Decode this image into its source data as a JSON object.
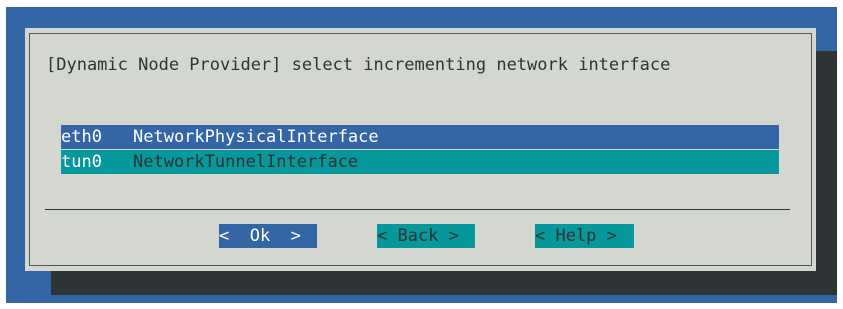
{
  "dialog": {
    "title": "[Dynamic Node Provider] select incrementing network interface"
  },
  "menu": {
    "items": [
      {
        "tag": "eth0",
        "description": "NetworkPhysicalInterface",
        "selected": true
      },
      {
        "tag": "tun0",
        "description": "NetworkTunnelInterface",
        "selected": false
      }
    ]
  },
  "buttons": {
    "ok": "<  Ok  >",
    "back": "< Back >",
    "help": "< Help >"
  },
  "colors": {
    "screen": "#3465a4",
    "dialog": "#d3d7cf",
    "selected_row": "#3465a4",
    "unselected_row": "#06989a",
    "shadow": "#2e3436"
  }
}
